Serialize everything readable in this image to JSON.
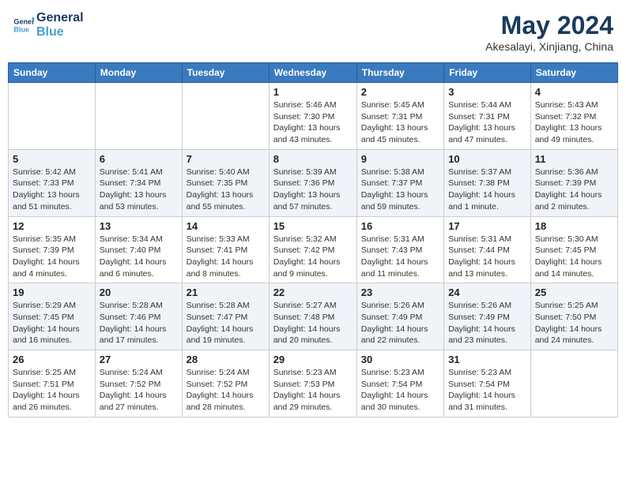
{
  "header": {
    "logo_line1": "General",
    "logo_line2": "Blue",
    "month_title": "May 2024",
    "subtitle": "Akesalayi, Xinjiang, China"
  },
  "weekdays": [
    "Sunday",
    "Monday",
    "Tuesday",
    "Wednesday",
    "Thursday",
    "Friday",
    "Saturday"
  ],
  "weeks": [
    [
      {
        "day": "",
        "info": ""
      },
      {
        "day": "",
        "info": ""
      },
      {
        "day": "",
        "info": ""
      },
      {
        "day": "1",
        "info": "Sunrise: 5:46 AM\nSunset: 7:30 PM\nDaylight: 13 hours\nand 43 minutes."
      },
      {
        "day": "2",
        "info": "Sunrise: 5:45 AM\nSunset: 7:31 PM\nDaylight: 13 hours\nand 45 minutes."
      },
      {
        "day": "3",
        "info": "Sunrise: 5:44 AM\nSunset: 7:31 PM\nDaylight: 13 hours\nand 47 minutes."
      },
      {
        "day": "4",
        "info": "Sunrise: 5:43 AM\nSunset: 7:32 PM\nDaylight: 13 hours\nand 49 minutes."
      }
    ],
    [
      {
        "day": "5",
        "info": "Sunrise: 5:42 AM\nSunset: 7:33 PM\nDaylight: 13 hours\nand 51 minutes."
      },
      {
        "day": "6",
        "info": "Sunrise: 5:41 AM\nSunset: 7:34 PM\nDaylight: 13 hours\nand 53 minutes."
      },
      {
        "day": "7",
        "info": "Sunrise: 5:40 AM\nSunset: 7:35 PM\nDaylight: 13 hours\nand 55 minutes."
      },
      {
        "day": "8",
        "info": "Sunrise: 5:39 AM\nSunset: 7:36 PM\nDaylight: 13 hours\nand 57 minutes."
      },
      {
        "day": "9",
        "info": "Sunrise: 5:38 AM\nSunset: 7:37 PM\nDaylight: 13 hours\nand 59 minutes."
      },
      {
        "day": "10",
        "info": "Sunrise: 5:37 AM\nSunset: 7:38 PM\nDaylight: 14 hours\nand 1 minute."
      },
      {
        "day": "11",
        "info": "Sunrise: 5:36 AM\nSunset: 7:39 PM\nDaylight: 14 hours\nand 2 minutes."
      }
    ],
    [
      {
        "day": "12",
        "info": "Sunrise: 5:35 AM\nSunset: 7:39 PM\nDaylight: 14 hours\nand 4 minutes."
      },
      {
        "day": "13",
        "info": "Sunrise: 5:34 AM\nSunset: 7:40 PM\nDaylight: 14 hours\nand 6 minutes."
      },
      {
        "day": "14",
        "info": "Sunrise: 5:33 AM\nSunset: 7:41 PM\nDaylight: 14 hours\nand 8 minutes."
      },
      {
        "day": "15",
        "info": "Sunrise: 5:32 AM\nSunset: 7:42 PM\nDaylight: 14 hours\nand 9 minutes."
      },
      {
        "day": "16",
        "info": "Sunrise: 5:31 AM\nSunset: 7:43 PM\nDaylight: 14 hours\nand 11 minutes."
      },
      {
        "day": "17",
        "info": "Sunrise: 5:31 AM\nSunset: 7:44 PM\nDaylight: 14 hours\nand 13 minutes."
      },
      {
        "day": "18",
        "info": "Sunrise: 5:30 AM\nSunset: 7:45 PM\nDaylight: 14 hours\nand 14 minutes."
      }
    ],
    [
      {
        "day": "19",
        "info": "Sunrise: 5:29 AM\nSunset: 7:45 PM\nDaylight: 14 hours\nand 16 minutes."
      },
      {
        "day": "20",
        "info": "Sunrise: 5:28 AM\nSunset: 7:46 PM\nDaylight: 14 hours\nand 17 minutes."
      },
      {
        "day": "21",
        "info": "Sunrise: 5:28 AM\nSunset: 7:47 PM\nDaylight: 14 hours\nand 19 minutes."
      },
      {
        "day": "22",
        "info": "Sunrise: 5:27 AM\nSunset: 7:48 PM\nDaylight: 14 hours\nand 20 minutes."
      },
      {
        "day": "23",
        "info": "Sunrise: 5:26 AM\nSunset: 7:49 PM\nDaylight: 14 hours\nand 22 minutes."
      },
      {
        "day": "24",
        "info": "Sunrise: 5:26 AM\nSunset: 7:49 PM\nDaylight: 14 hours\nand 23 minutes."
      },
      {
        "day": "25",
        "info": "Sunrise: 5:25 AM\nSunset: 7:50 PM\nDaylight: 14 hours\nand 24 minutes."
      }
    ],
    [
      {
        "day": "26",
        "info": "Sunrise: 5:25 AM\nSunset: 7:51 PM\nDaylight: 14 hours\nand 26 minutes."
      },
      {
        "day": "27",
        "info": "Sunrise: 5:24 AM\nSunset: 7:52 PM\nDaylight: 14 hours\nand 27 minutes."
      },
      {
        "day": "28",
        "info": "Sunrise: 5:24 AM\nSunset: 7:52 PM\nDaylight: 14 hours\nand 28 minutes."
      },
      {
        "day": "29",
        "info": "Sunrise: 5:23 AM\nSunset: 7:53 PM\nDaylight: 14 hours\nand 29 minutes."
      },
      {
        "day": "30",
        "info": "Sunrise: 5:23 AM\nSunset: 7:54 PM\nDaylight: 14 hours\nand 30 minutes."
      },
      {
        "day": "31",
        "info": "Sunrise: 5:23 AM\nSunset: 7:54 PM\nDaylight: 14 hours\nand 31 minutes."
      },
      {
        "day": "",
        "info": ""
      }
    ]
  ]
}
